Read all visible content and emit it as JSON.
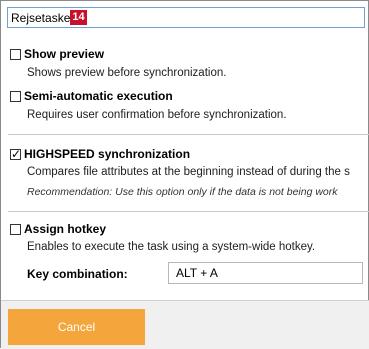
{
  "task": {
    "name": "Rejsetaske",
    "badge": "14"
  },
  "options": {
    "show_preview": {
      "title": "Show preview",
      "description": "Shows preview before synchronization.",
      "checked": false
    },
    "semi_automatic": {
      "title": "Semi-automatic execution",
      "description": "Requires user confirmation before synchronization.",
      "checked": false
    },
    "highspeed": {
      "title": "HIGHSPEED synchronization",
      "description": "Compares file attributes at the beginning instead of during the s",
      "note": "Recommendation: Use this option only if the data is not being work",
      "checked": true,
      "check_glyph": "✓"
    },
    "hotkey": {
      "title": "Assign hotkey",
      "description": "Enables to execute the task using a system-wide hotkey.",
      "checked": false,
      "key_label": "Key combination:",
      "key_value": "ALT + A"
    }
  },
  "footer": {
    "cancel_label": "Cancel"
  },
  "colors": {
    "cancel_button": "#f4a53c",
    "badge": "#c8102e",
    "input_focus_border": "#6fa0d6"
  }
}
